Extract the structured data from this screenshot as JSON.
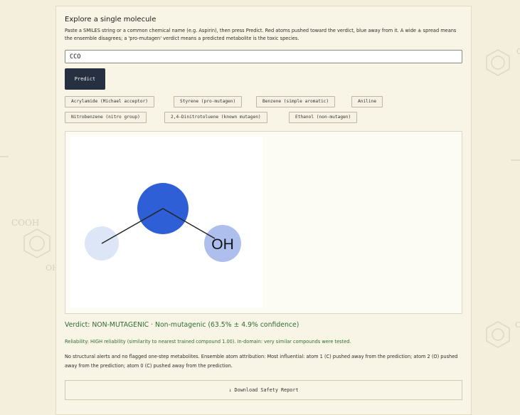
{
  "background": {
    "deco_labels": [
      "COOH",
      "OH",
      "OH",
      "OH",
      "OH"
    ],
    "colors": {
      "page": "#f4efdc",
      "deco": "#d9d3c0"
    }
  },
  "card": {
    "title": "Explore a single molecule",
    "description": "Paste a SMILES string or a common chemical name (e.g. Aspirin), then press Predict. Red atoms pushed toward the verdict, blue away from it. A wide ± spread means the ensemble disagrees; a 'pro-mutagen' verdict means a predicted metabolite is the toxic species."
  },
  "input": {
    "value": "CCO",
    "placeholder": ""
  },
  "predict_button": {
    "label": "Predict"
  },
  "examples": [
    "Acrylamide (Michael acceptor)",
    "Styrene (pro-mutagen)",
    "Benzene (simple aromatic)",
    "Aniline",
    "Nitrobenzene (nitro group)",
    "2,4-Dinitrotoluene (known mutagen)",
    "Ethanol (non-mutagen)"
  ],
  "molecule": {
    "atom_label": "OH",
    "colors": {
      "atom_strong": "#2f5fd6",
      "atom_weak": "#dde6f7",
      "atom_oh": "#aebfee",
      "bond": "#222222"
    }
  },
  "result": {
    "verdict": "Verdict: NON-MUTAGENIC · Non-mutagenic (63.5% ± 4.9% confidence)",
    "reliability": "Reliability: HIGH reliability (similarity to nearest trained compound 1.00). In-domain: very similar compounds were tested.",
    "notes": "No structural alerts and no flagged one-step metabolites. Ensemble atom attribution: Most influential: atom 1 (C) pushed away from the prediction; atom 2 (O) pushed away from the prediction; atom 0 (C) pushed away from the prediction.",
    "verdict_color": "#2e6b34"
  },
  "download_button": {
    "icon": "download-arrow-icon",
    "glyph": "↓",
    "label": "Download Safety Report"
  }
}
